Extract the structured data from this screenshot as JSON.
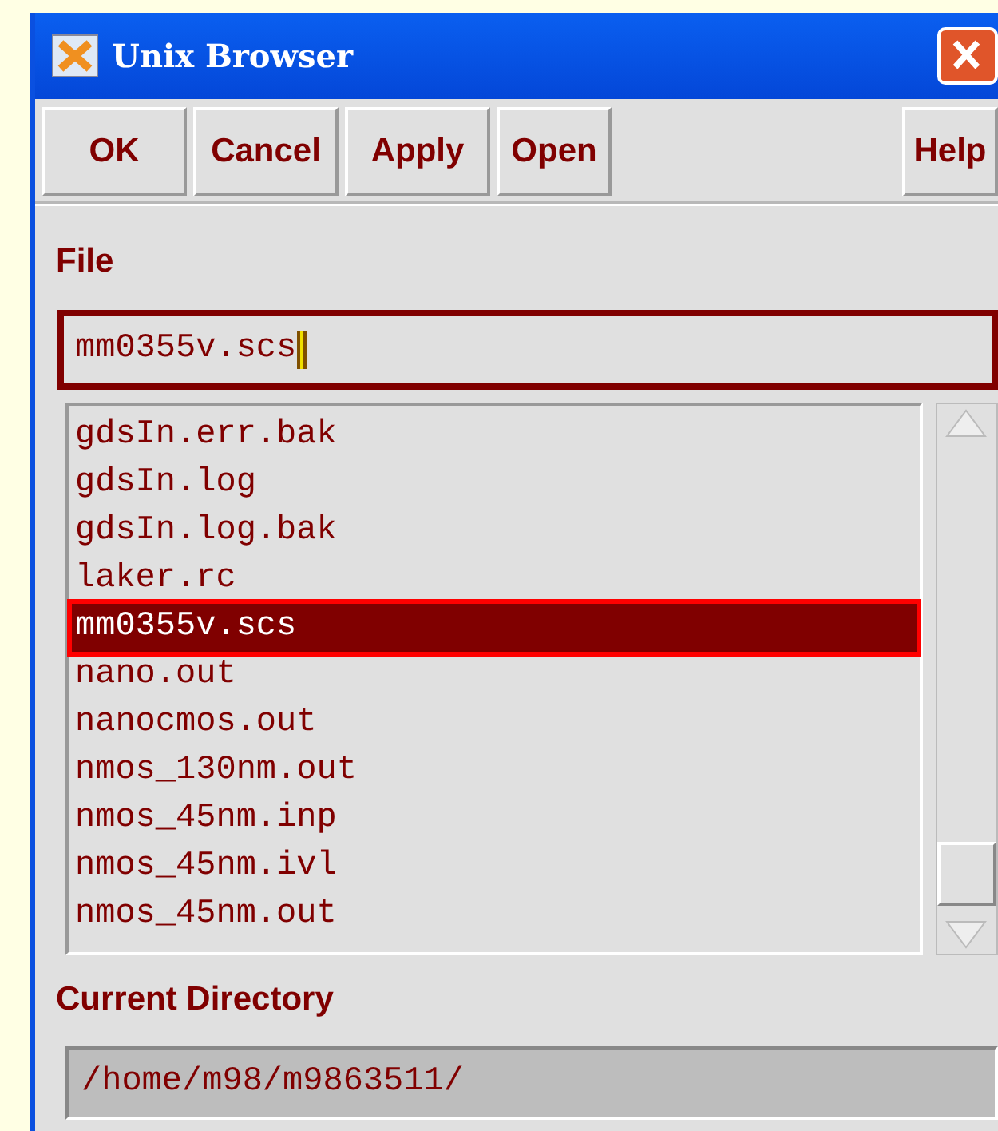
{
  "window": {
    "title": "Unix Browser"
  },
  "buttons": [
    {
      "label": "OK"
    },
    {
      "label": "Cancel"
    },
    {
      "label": "Apply"
    },
    {
      "label": "Open"
    }
  ],
  "help_button": {
    "label": "Help"
  },
  "file_label": "File",
  "file_input": {
    "value": "mm0355v.scs"
  },
  "file_list": [
    {
      "name": "gdsIn.err.bak",
      "selected": false
    },
    {
      "name": "gdsIn.log",
      "selected": false
    },
    {
      "name": "gdsIn.log.bak",
      "selected": false
    },
    {
      "name": "laker.rc",
      "selected": false
    },
    {
      "name": "mm0355v.scs",
      "selected": true
    },
    {
      "name": "nano.out",
      "selected": false
    },
    {
      "name": "nanocmos.out",
      "selected": false
    },
    {
      "name": "nmos_130nm.out",
      "selected": false
    },
    {
      "name": "nmos_45nm.inp",
      "selected": false
    },
    {
      "name": "nmos_45nm.ivl",
      "selected": false
    },
    {
      "name": "nmos_45nm.out",
      "selected": false
    }
  ],
  "directory_label": "Current Directory",
  "directory": {
    "value": "/home/m98/m9863511/"
  }
}
